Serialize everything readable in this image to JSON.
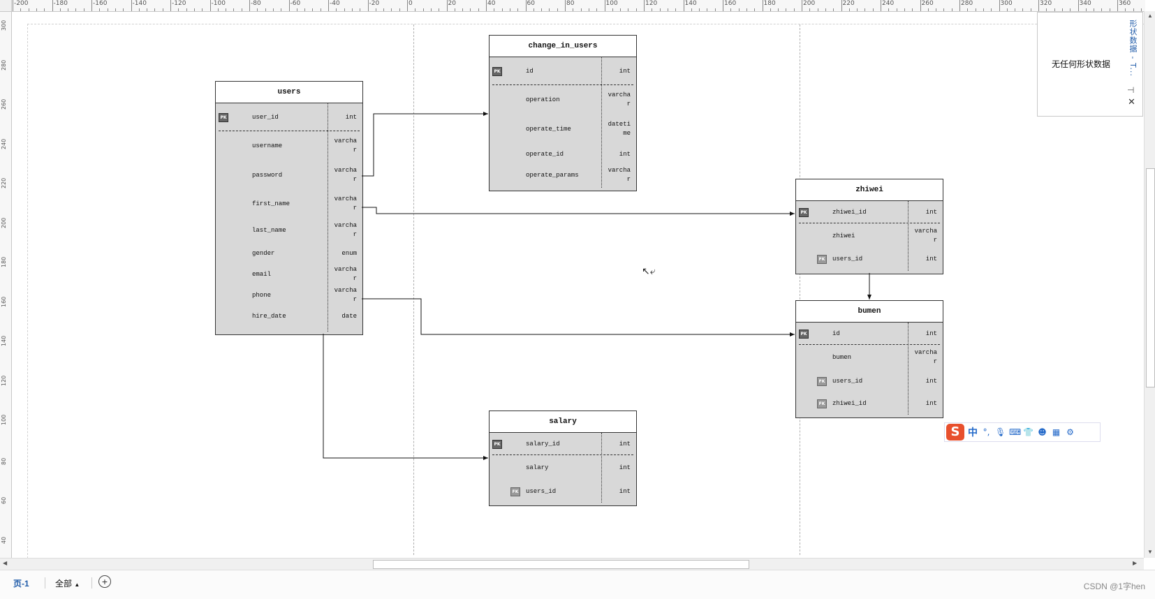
{
  "ruler": {
    "top_labels": [
      "-200",
      "-180",
      "-160",
      "-140",
      "-120",
      "-100",
      "-80",
      "-60",
      "-40",
      "-20",
      "0",
      "20",
      "40",
      "60",
      "80",
      "100",
      "120",
      "140",
      "160",
      "180",
      "200",
      "220",
      "240",
      "260",
      "280",
      "300",
      "320",
      "340",
      "360"
    ],
    "left_labels": [
      "300",
      "280",
      "260",
      "240",
      "220",
      "200",
      "180",
      "160",
      "140",
      "120",
      "100",
      "80",
      "60",
      "40"
    ]
  },
  "entities": {
    "users": {
      "title": "users",
      "fields": [
        {
          "name": "user_id",
          "type": "int",
          "key": "PK"
        },
        {
          "name": "username",
          "type": "varchar"
        },
        {
          "name": "password",
          "type": "varchar"
        },
        {
          "name": "first_name",
          "type": "varchar"
        },
        {
          "name": "last_name",
          "type": "varchar"
        },
        {
          "name": "gender",
          "type": "enum"
        },
        {
          "name": "email",
          "type": "varchar"
        },
        {
          "name": "phone",
          "type": "varchar"
        },
        {
          "name": "hire_date",
          "type": "date"
        }
      ]
    },
    "change_in_users": {
      "title": "change_in_users",
      "fields": [
        {
          "name": "id",
          "type": "int",
          "key": "PK"
        },
        {
          "name": "operation",
          "type": "varchar"
        },
        {
          "name": "operate_time",
          "type": "datetime"
        },
        {
          "name": "operate_id",
          "type": "int"
        },
        {
          "name": "operate_params",
          "type": "varchar"
        }
      ]
    },
    "zhiwei": {
      "title": "zhiwei",
      "fields": [
        {
          "name": "zhiwei_id",
          "type": "int",
          "key": "PK"
        },
        {
          "name": "zhiwei",
          "type": "varchar"
        },
        {
          "name": "users_id",
          "type": "int",
          "key": "FK"
        }
      ]
    },
    "bumen": {
      "title": "bumen",
      "fields": [
        {
          "name": "id",
          "type": "int",
          "key": "PK"
        },
        {
          "name": "bumen",
          "type": "varchar"
        },
        {
          "name": "users_id",
          "type": "int",
          "key": "FK"
        },
        {
          "name": "zhiwei_id",
          "type": "int",
          "key": "FK"
        }
      ]
    },
    "salary": {
      "title": "salary",
      "fields": [
        {
          "name": "salary_id",
          "type": "int",
          "key": "PK"
        },
        {
          "name": "salary",
          "type": "int"
        },
        {
          "name": "users_id",
          "type": "int",
          "key": "FK"
        }
      ]
    }
  },
  "shape_panel": {
    "title": "形状数据 - T...",
    "empty_text": "无任何形状数据",
    "pin": "⊣",
    "close": "✕"
  },
  "tabs": {
    "page": "页-1",
    "all": "全部",
    "add": "+"
  },
  "ime": {
    "chinese": "中",
    "punct": "°,"
  },
  "watermark": "CSDN @1字hen"
}
